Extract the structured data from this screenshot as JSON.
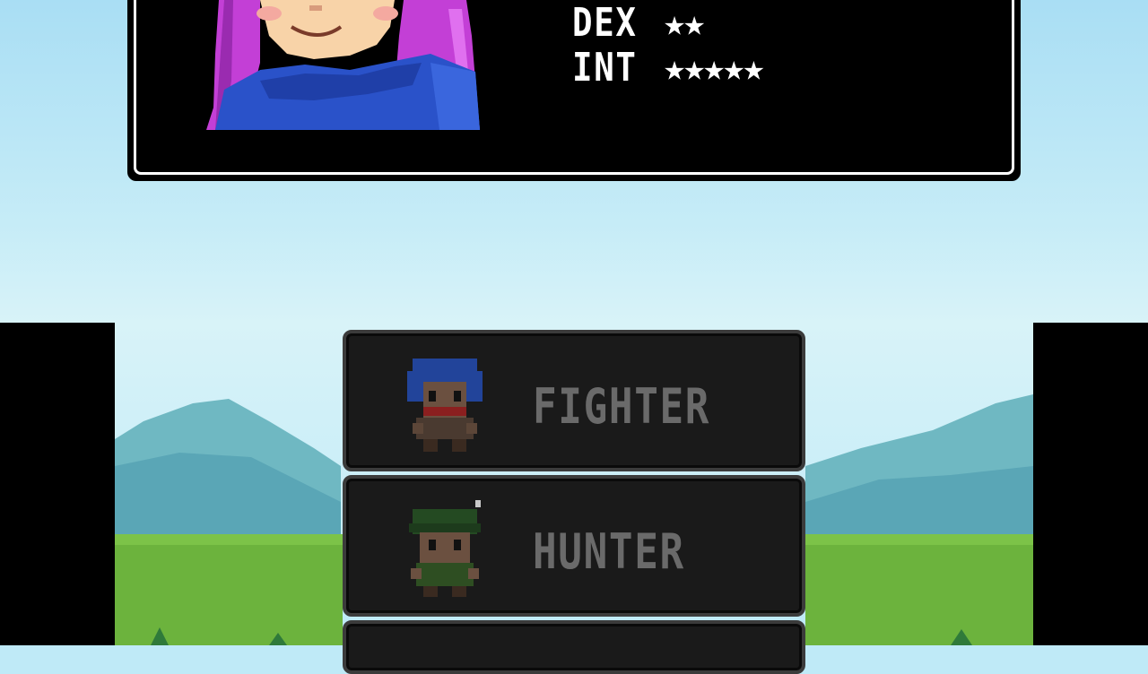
{
  "stats": [
    {
      "name": "DEX",
      "stars": "★★",
      "rating": 2
    },
    {
      "name": "INT",
      "stars": "★★★★★",
      "rating": 5
    }
  ],
  "classes": [
    {
      "label": "FIGHTER"
    },
    {
      "label": "HUNTER"
    },
    {
      "label": ""
    }
  ],
  "colors": {
    "panel_bg": "#000000",
    "panel_border": "#ffffff",
    "button_bg": "#1a1a1a",
    "button_border": "#3b3b3b",
    "button_text_disabled": "#6a6a6a",
    "hair": "#c33fd6",
    "scarf": "#2a52c9",
    "mountain": "#6fb8c2",
    "grass": "#6cb33d"
  },
  "icons": [
    "portrait-mage-girl",
    "fighter-sprite-icon",
    "hunter-sprite-icon"
  ]
}
